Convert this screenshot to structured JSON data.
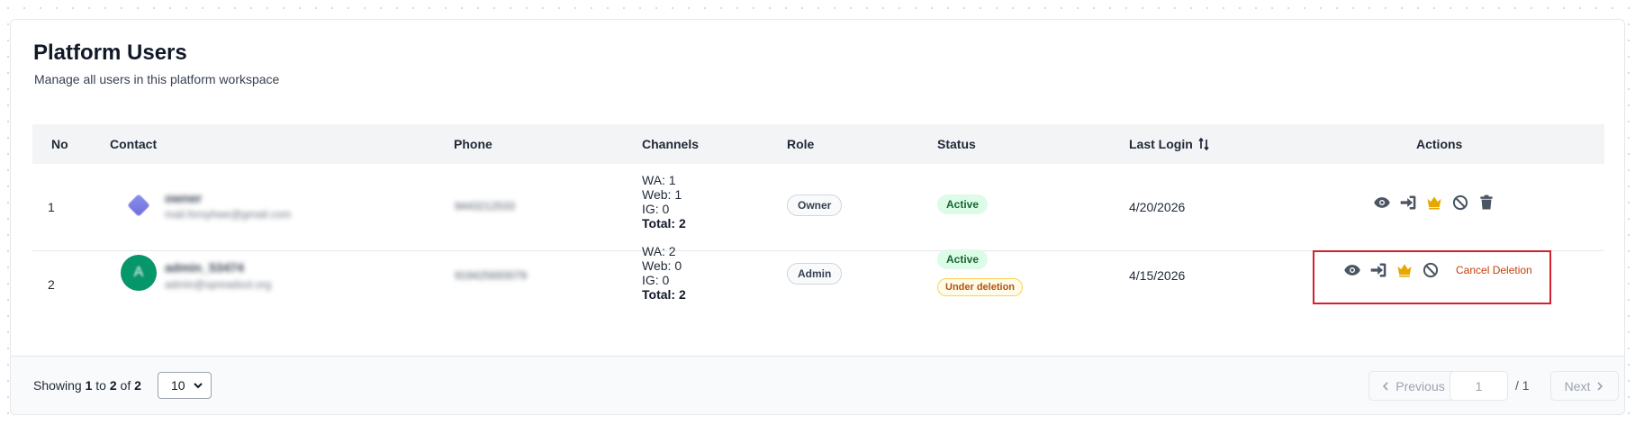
{
  "header": {
    "title": "Platform Users",
    "subtitle": "Manage all users in this platform workspace"
  },
  "table": {
    "columns": [
      "No",
      "Contact",
      "Phone",
      "Channels",
      "Role",
      "Status",
      "Last Login",
      "Actions"
    ],
    "sort_icon": "sort-arrows-icon",
    "rows": [
      {
        "no": "1",
        "contact_name": "owner",
        "contact_email": "mail.forsyhwe@gmail.com",
        "avatar": "logo",
        "phone": "9443212533",
        "channels": {
          "wa": "WA: 1",
          "web": "Web: 1",
          "ig": "IG: 0",
          "total": "Total: 2"
        },
        "role": "Owner",
        "status": "Active",
        "last_login": "4/20/2026"
      },
      {
        "no": "2",
        "contact_name": "admin_53474",
        "contact_email": "admin@spreadsot.org",
        "avatar": "A",
        "phone": "919425693079",
        "channels": {
          "wa": "WA: 2",
          "web": "Web: 0",
          "ig": "IG: 0",
          "total": "Total: 2"
        },
        "role": "Admin",
        "status": "Active",
        "status_extra": "Under deletion",
        "last_login": "4/15/2026",
        "cancel_deletion": "Cancel Deletion"
      }
    ]
  },
  "actions_icons": [
    "eye-icon",
    "login-icon",
    "crown-icon",
    "ban-icon",
    "trash-icon"
  ],
  "colors": {
    "crown": "#e6a700",
    "cancel": "#c2410c",
    "highlight": "#d2202f",
    "active_bg": "#dcfce7",
    "deletion_border": "#fcd34d"
  },
  "footer": {
    "showing_prefix": "Showing",
    "from": "1",
    "to_word": "to",
    "to": "2",
    "of_word": "of",
    "total": "2",
    "per_page": "10",
    "previous": "Previous",
    "page": "1",
    "page_total": "/ 1",
    "next": "Next"
  }
}
